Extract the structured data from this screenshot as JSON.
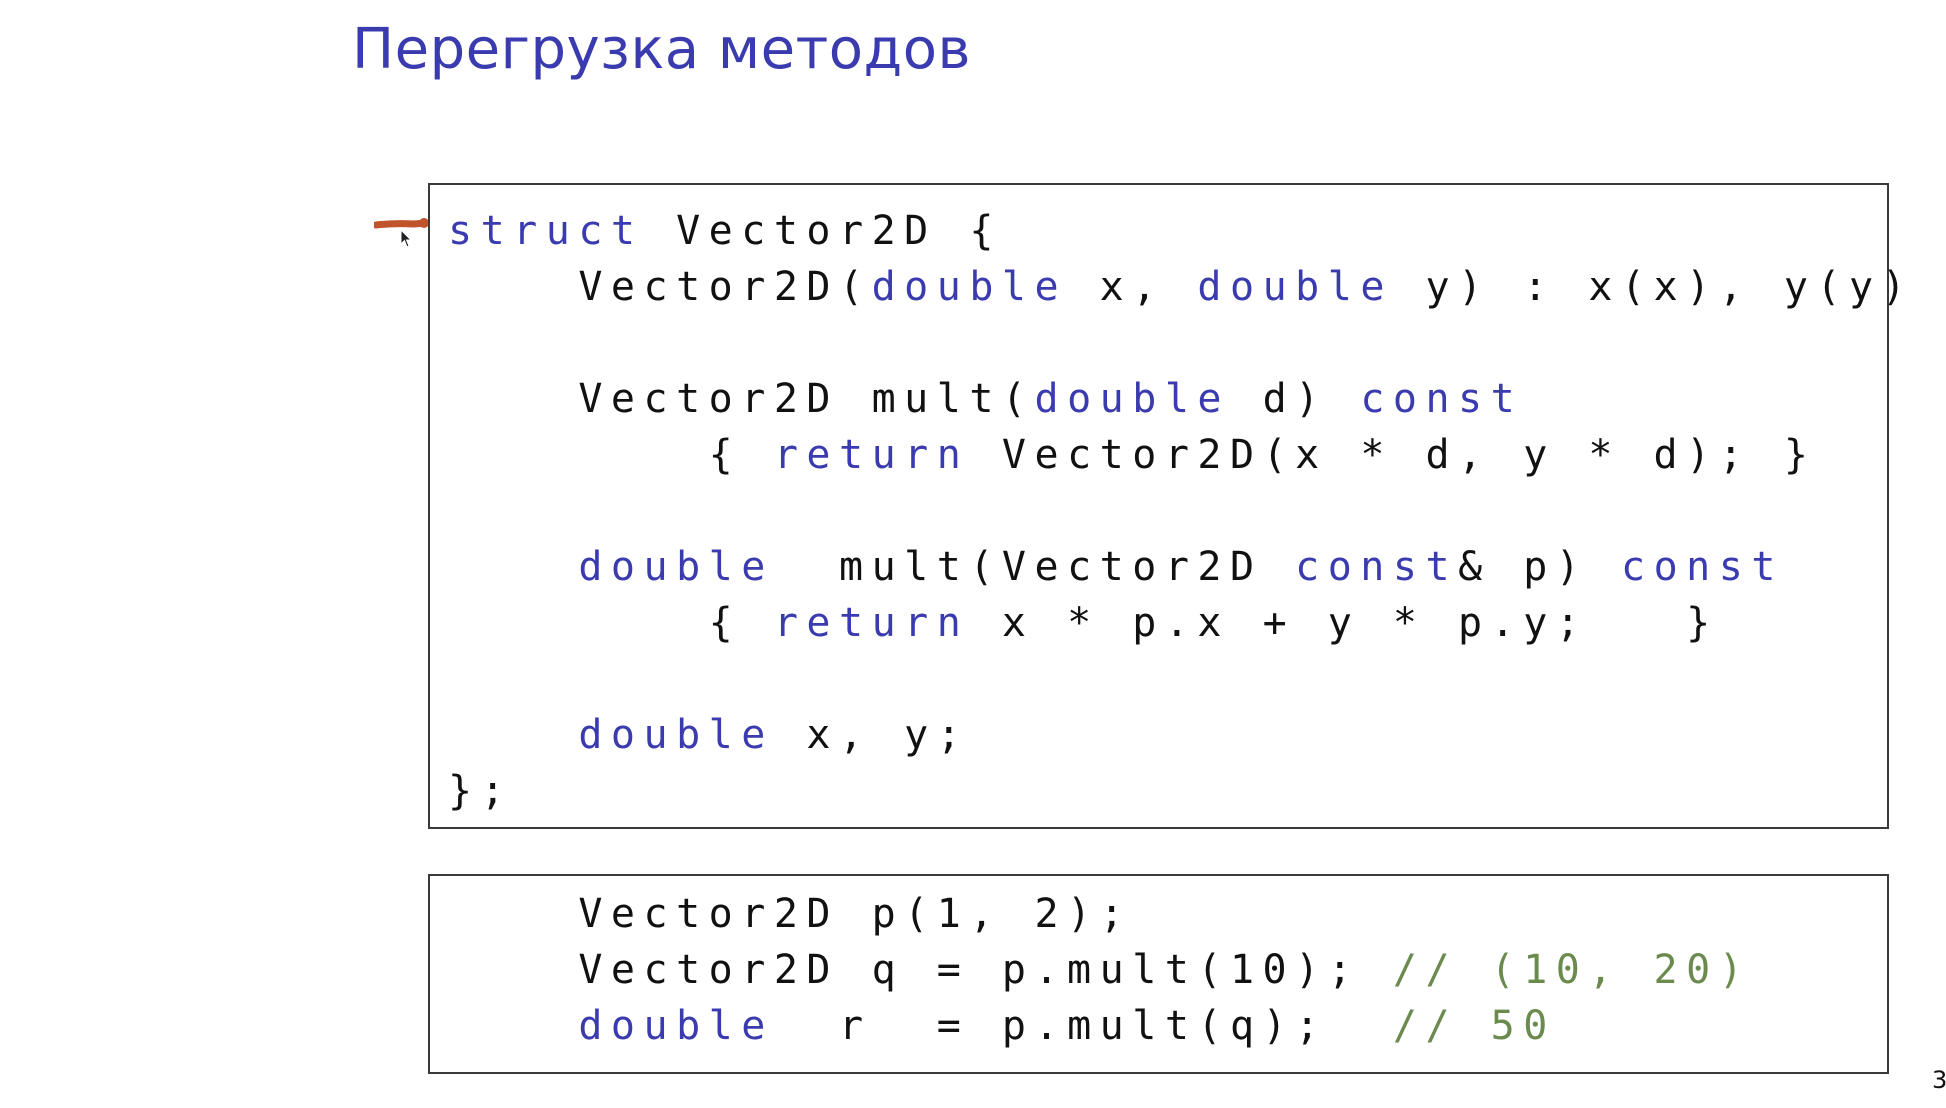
{
  "title": "Перегрузка методов",
  "page_number": "3",
  "code_block_1": {
    "lines": [
      [
        {
          "t": "struct",
          "k": "kw"
        },
        {
          "t": " Vector2D {",
          "k": ""
        }
      ],
      [
        {
          "t": "    Vector2D(",
          "k": ""
        },
        {
          "t": "double",
          "k": "kw"
        },
        {
          "t": " x, ",
          "k": ""
        },
        {
          "t": "double",
          "k": "kw"
        },
        {
          "t": " y) : x(x), y(y) {}",
          "k": ""
        }
      ],
      [],
      [
        {
          "t": "    Vector2D mult(",
          "k": ""
        },
        {
          "t": "double",
          "k": "kw"
        },
        {
          "t": " d) ",
          "k": ""
        },
        {
          "t": "const",
          "k": "kw"
        }
      ],
      [
        {
          "t": "        { ",
          "k": ""
        },
        {
          "t": "return",
          "k": "kw"
        },
        {
          "t": " Vector2D(x * d, y * d); }",
          "k": ""
        }
      ],
      [],
      [
        {
          "t": "    ",
          "k": ""
        },
        {
          "t": "double",
          "k": "kw"
        },
        {
          "t": "  mult(Vector2D ",
          "k": ""
        },
        {
          "t": "const",
          "k": "kw"
        },
        {
          "t": "& p) ",
          "k": ""
        },
        {
          "t": "const",
          "k": "kw"
        }
      ],
      [
        {
          "t": "        { ",
          "k": ""
        },
        {
          "t": "return",
          "k": "kw"
        },
        {
          "t": " x * p.x + y * p.y;   }",
          "k": ""
        }
      ],
      [],
      [
        {
          "t": "    ",
          "k": ""
        },
        {
          "t": "double",
          "k": "kw"
        },
        {
          "t": " x, y;",
          "k": ""
        }
      ],
      [
        {
          "t": "};",
          "k": ""
        }
      ]
    ]
  },
  "code_block_2": {
    "lines": [
      [
        {
          "t": "    Vector2D p(1, 2);",
          "k": ""
        }
      ],
      [
        {
          "t": "    Vector2D q = p.mult(10); ",
          "k": ""
        },
        {
          "t": "// (10, 20)",
          "k": "cm"
        }
      ],
      [
        {
          "t": "    ",
          "k": ""
        },
        {
          "t": "double",
          "k": "kw"
        },
        {
          "t": "  r  = p.mult(q);  ",
          "k": ""
        },
        {
          "t": "// 50",
          "k": "cm"
        }
      ]
    ]
  },
  "colors": {
    "title": "#3b3bb0",
    "keyword": "#3b3bb0",
    "comment": "#6b8a4e",
    "pen_annotation": "#c0542a"
  },
  "icons": [
    "pen-stroke-annotation",
    "mouse-cursor-icon"
  ]
}
